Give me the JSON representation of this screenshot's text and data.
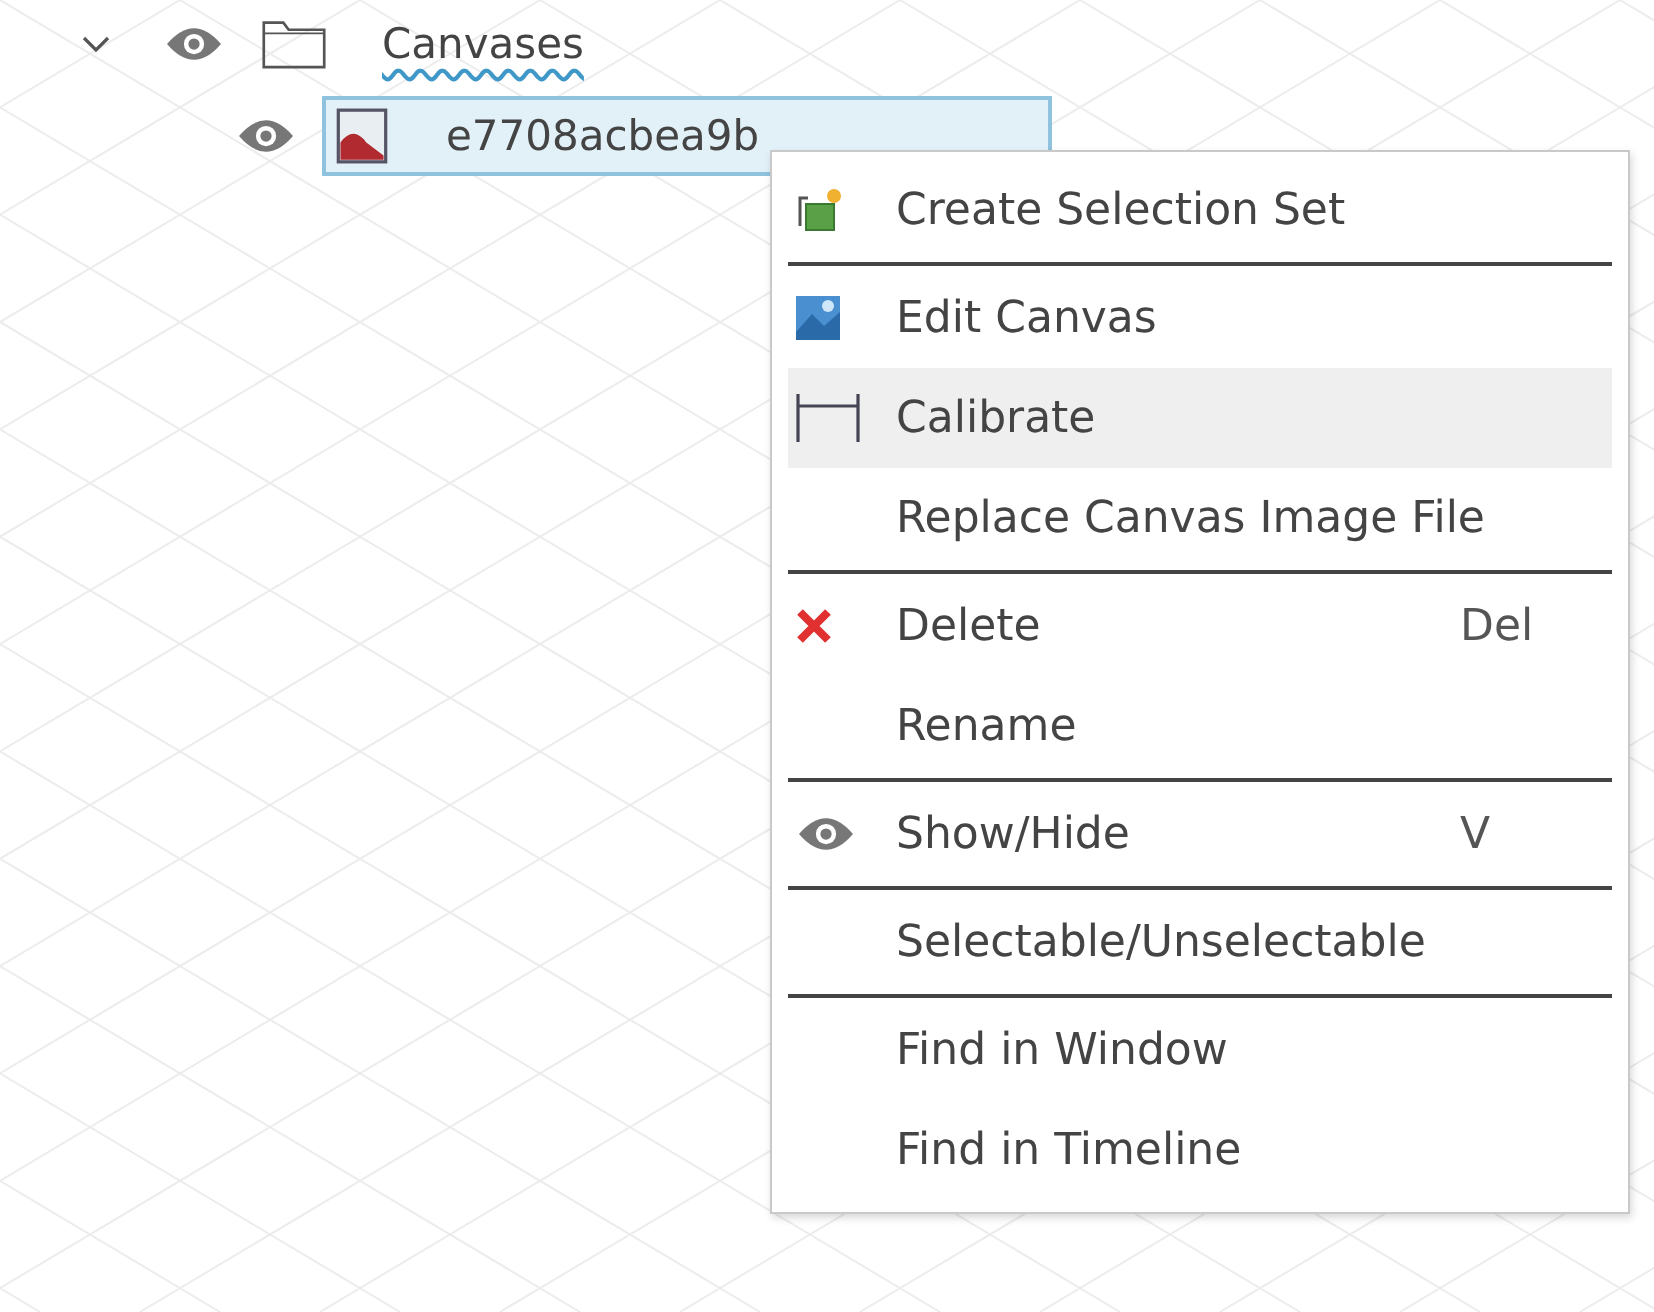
{
  "tree": [
    {
      "label": "Canvases",
      "kind": "folder",
      "expanded": true,
      "visible": true,
      "selected": false,
      "children": [
        {
          "label": "e7708acbea9b",
          "kind": "canvas",
          "visible": true,
          "selected": true
        }
      ]
    }
  ],
  "context_menu": {
    "items": [
      {
        "kind": "item",
        "label": "Create Selection Set",
        "highlighted": false
      },
      {
        "kind": "separator"
      },
      {
        "kind": "item",
        "label": "Edit Canvas",
        "highlighted": false
      },
      {
        "kind": "item",
        "label": "Calibrate",
        "highlighted": true
      },
      {
        "kind": "item",
        "label": "Replace Canvas Image File",
        "highlighted": false
      },
      {
        "kind": "separator"
      },
      {
        "kind": "item",
        "label": "Delete",
        "shortcut": "Del",
        "highlighted": false
      },
      {
        "kind": "item",
        "label": "Rename",
        "highlighted": false
      },
      {
        "kind": "separator"
      },
      {
        "kind": "item",
        "label": "Show/Hide",
        "shortcut": "V",
        "highlighted": false
      },
      {
        "kind": "separator"
      },
      {
        "kind": "item",
        "label": "Selectable/Unselectable",
        "highlighted": false
      },
      {
        "kind": "separator"
      },
      {
        "kind": "item",
        "label": "Find in Window",
        "highlighted": false
      },
      {
        "kind": "item",
        "label": "Find in Timeline",
        "highlighted": false
      }
    ]
  }
}
